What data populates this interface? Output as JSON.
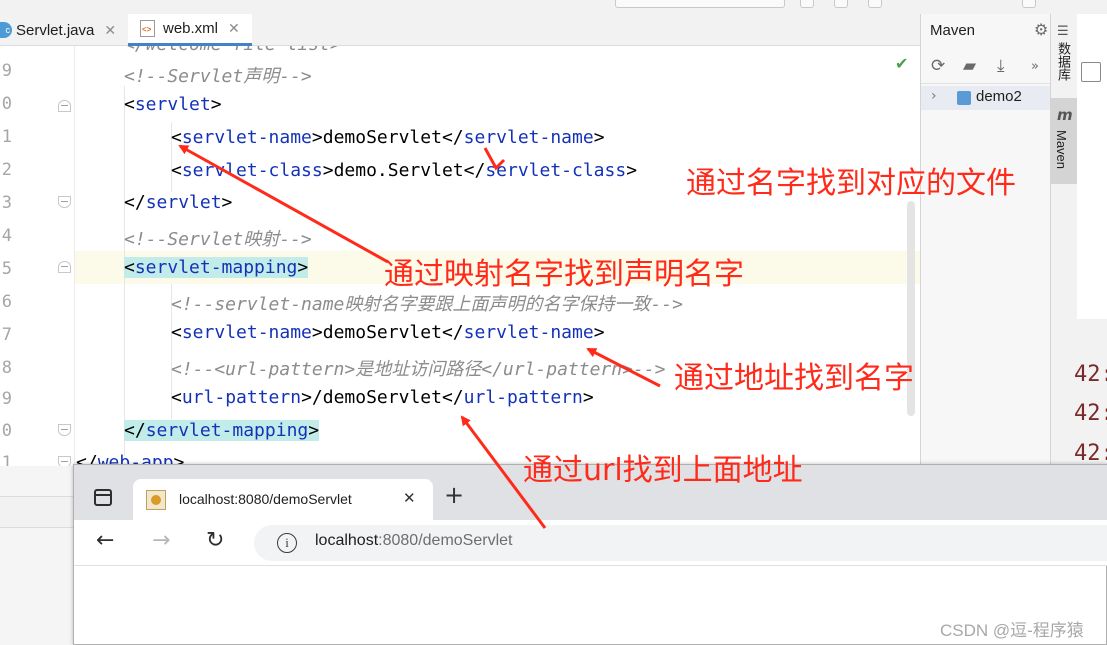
{
  "editor": {
    "tabs": [
      {
        "label": "Servlet.java",
        "icon": "java-class-icon"
      },
      {
        "label": "web.xml",
        "icon": "xml-file-icon"
      }
    ],
    "line_numbers": [
      "9",
      "0",
      "1",
      "2",
      "3",
      "4",
      "5",
      "6",
      "7",
      "8",
      "9",
      "0",
      "1"
    ],
    "code": {
      "l0": "</welcome-file-list>",
      "l1_comment": "<!--Servlet声明-->",
      "l2_tag": "servlet",
      "l3_open": "servlet-name",
      "l3_text": "demoServlet",
      "l3_close": "servlet-name",
      "l4_open": "servlet-class",
      "l4_text": "demo.Servlet",
      "l4_close": "servlet-class",
      "l5_tag": "servlet",
      "l6_comment": "<!--Servlet映射-->",
      "l7_tag": "servlet-mapping",
      "l8_comment": "<!--servlet-name映射名字要跟上面声明的名字保持一致-->",
      "l9_open": "servlet-name",
      "l9_text": "demoServlet",
      "l9_close": "servlet-name",
      "l10_comment": "<!--<url-pattern>是地址访问路径</url-pattern>-->",
      "l11_open": "url-pattern",
      "l11_text": "/demoServlet",
      "l11_close": "url-pattern",
      "l12_tag": "servlet-mapping",
      "l13_tag": "web-app"
    }
  },
  "maven": {
    "title": "Maven",
    "tree_item": "demo2"
  },
  "side_bar": {
    "database": "数据库",
    "maven": "Maven",
    "maven_icon": "m"
  },
  "log_fragments": [
    "42:",
    "42:",
    "42:"
  ],
  "browser": {
    "tab_title": "localhost:8080/demoServlet",
    "url_host": "localhost",
    "url_rest": ":8080/demoServlet"
  },
  "annotations": {
    "a1": "通过名字找到对应的文件",
    "a2": "通过映射名字找到声明名字",
    "a3": "通过地址找到名字",
    "a4": "通过url找到上面地址"
  },
  "watermark": "CSDN @逗-程序猿",
  "colors": {
    "annotation": "#ff2a1a",
    "xml_tag": "#1432b8",
    "comment": "#8c8c8c",
    "highlight_tag": "#c2ece9"
  }
}
